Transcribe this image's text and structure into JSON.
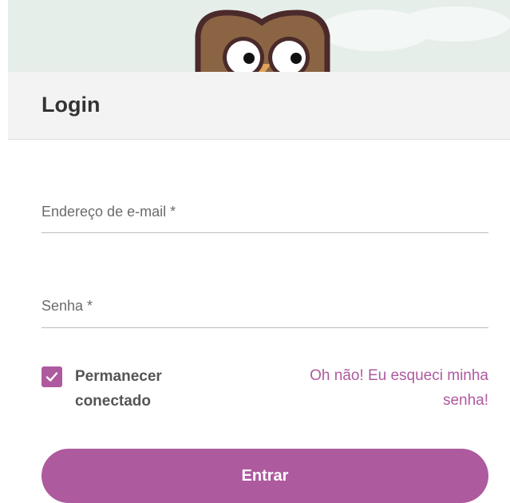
{
  "header": {
    "title": "Login"
  },
  "form": {
    "email_label": "Endereço de e-mail *",
    "email_value": "",
    "password_label": "Senha *",
    "password_value": "",
    "remember_label": "Permanecer conectado",
    "remember_checked": true,
    "forgot_link": "Oh não! Eu esqueci minha senha!",
    "submit_label": "Entrar"
  },
  "colors": {
    "accent": "#ae5a9f",
    "banner_bg": "#e6eeea",
    "header_bg": "#f3f3f3",
    "owl_body": "#8b6444",
    "owl_outline": "#4a2a2a"
  },
  "icons": {
    "mascot": "owl-mascot-icon",
    "checkbox": "check-icon"
  }
}
